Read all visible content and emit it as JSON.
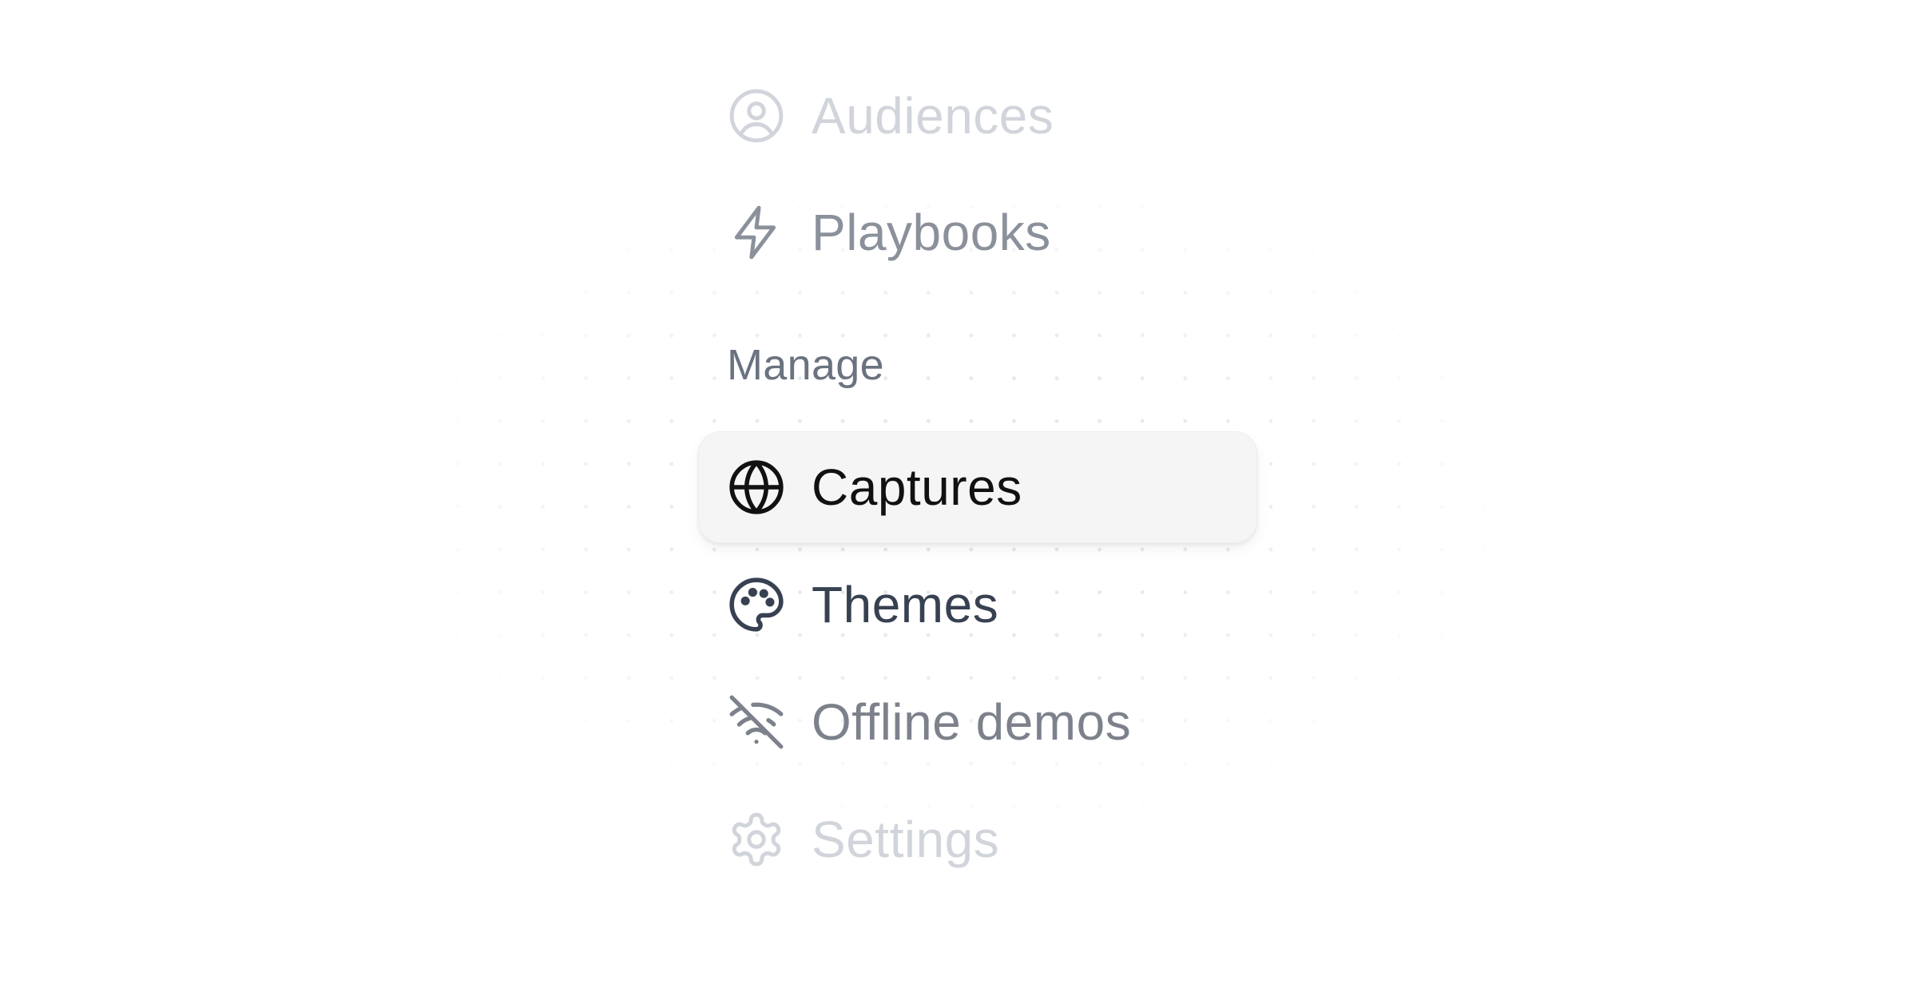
{
  "nav": {
    "items_top": [
      {
        "label": "Audiences",
        "icon": "user-circle-icon",
        "color": "#d1d5db"
      },
      {
        "label": "Playbooks",
        "icon": "lightning-bolt-icon",
        "color": "#9ca3af"
      }
    ],
    "section_label": "Manage",
    "items_manage": [
      {
        "label": "Captures",
        "icon": "globe-icon",
        "color": "#111111",
        "active": true
      },
      {
        "label": "Themes",
        "icon": "palette-icon",
        "color": "#374151"
      },
      {
        "label": "Offline demos",
        "icon": "wifi-off-icon",
        "color": "#7c818b"
      },
      {
        "label": "Settings",
        "icon": "gear-icon",
        "color": "#d1d5db"
      }
    ]
  },
  "colors": {
    "active_background": "#f5f5f5",
    "section_label": "#6b7280",
    "dot_pattern": "#e3e6ea"
  }
}
